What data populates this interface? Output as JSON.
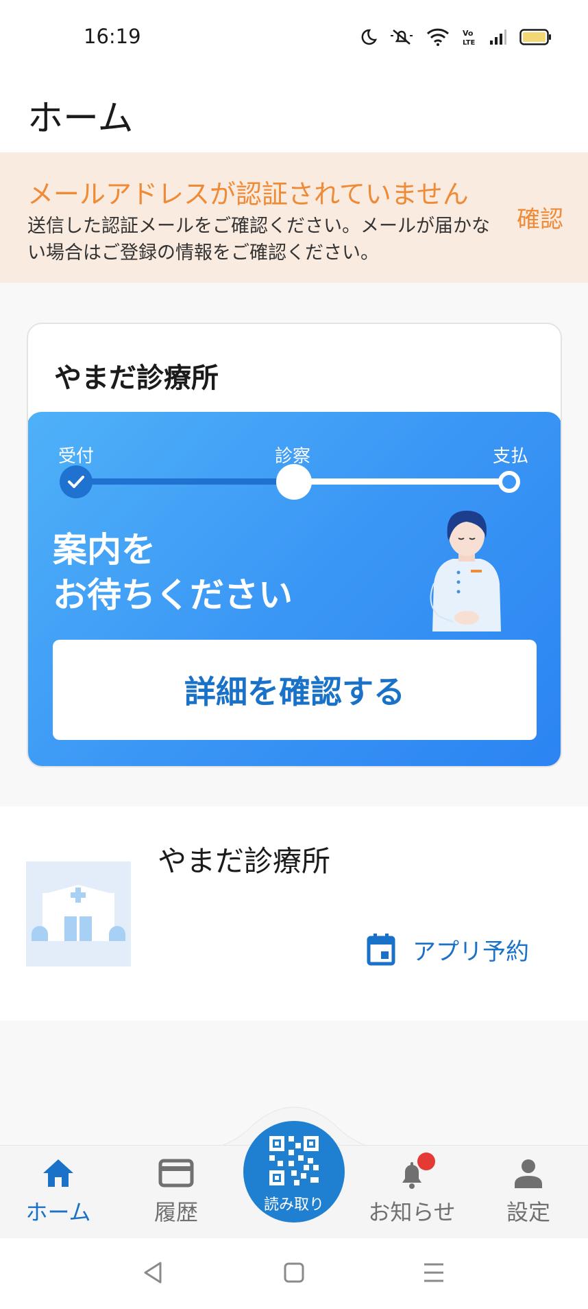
{
  "status_bar": {
    "time": "16:19"
  },
  "header": {
    "title": "ホーム"
  },
  "alert": {
    "title": "メールアドレスが認証されていません",
    "body": "送信した認証メールをご確認ください。メールが届かない場合はご登録の情報をご確認ください。",
    "action": "確認"
  },
  "visit_card": {
    "clinic_name": "やまだ診療所",
    "steps": [
      "受付",
      "診察",
      "支払"
    ],
    "current_step": 2,
    "message_line1": "案内を",
    "message_line2": "お待ちください",
    "button": "詳細を確認する"
  },
  "clinic_list": [
    {
      "name": "やまだ診療所",
      "action": "アプリ予約"
    }
  ],
  "bottom_nav": {
    "items": [
      {
        "label": "ホーム",
        "icon": "home-icon",
        "active": true
      },
      {
        "label": "履歴",
        "icon": "card-icon",
        "active": false
      },
      {
        "label": "お知らせ",
        "icon": "bell-icon",
        "active": false,
        "badge": true
      },
      {
        "label": "設定",
        "icon": "person-icon",
        "active": false
      }
    ],
    "scan": {
      "label": "読み取り",
      "icon": "qr-code-icon"
    }
  },
  "colors": {
    "accent": "#1a72c8",
    "alert_orange": "#ef8a36",
    "alert_bg": "#f9ebe0",
    "panel_blue": "#3b97f5",
    "badge_red": "#e53935"
  }
}
